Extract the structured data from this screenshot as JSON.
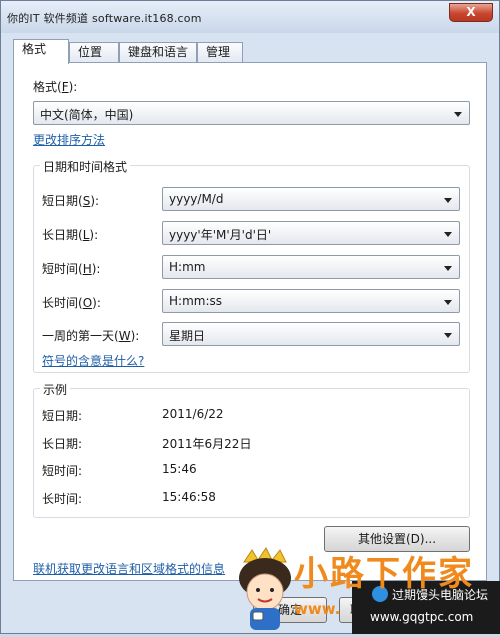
{
  "window": {
    "title": "你的IT 软件频道 software.it168.com",
    "close_label": "X"
  },
  "tabs": [
    {
      "label": "格式"
    },
    {
      "label": "位置"
    },
    {
      "label": "键盘和语言"
    },
    {
      "label": "管理"
    }
  ],
  "format": {
    "label": "格式(F):",
    "label_text": "格式(",
    "label_key": "F",
    "label_end": "):",
    "value": "中文(简体，中国)",
    "sort_link": "更改排序方法"
  },
  "datetime": {
    "group_title": "日期和时间格式",
    "rows": [
      {
        "label": "短日期",
        "key": "S",
        "value": "yyyy/M/d"
      },
      {
        "label": "长日期",
        "key": "L",
        "value": "yyyy'年'M'月'd'日'"
      },
      {
        "label": "短时间",
        "key": "H",
        "value": "H:mm"
      },
      {
        "label": "长时间",
        "key": "O",
        "value": "H:mm:ss"
      },
      {
        "label": "一周的第一天",
        "key": "W",
        "value": "星期日"
      }
    ],
    "symbols_link": "符号的含意是什么?"
  },
  "example": {
    "group_title": "示例",
    "rows": [
      {
        "label": "短日期:",
        "value": "2011/6/22"
      },
      {
        "label": "长日期:",
        "value": "2011年6月22日"
      },
      {
        "label": "短时间:",
        "value": "15:46"
      },
      {
        "label": "长时间:",
        "value": "15:46:58"
      }
    ]
  },
  "other_settings_button": "其他设置(D)...",
  "online_link": "联机获取更改语言和区域格式的信息",
  "footer": {
    "ok_label": "确定",
    "cancel_label_visible": "取"
  },
  "watermark": {
    "brand": "小路下作家",
    "site_url": "www.",
    "forum_text": "过期馒头电脑论坛",
    "forum_url": "www.gqgtpc.com"
  },
  "colors": {
    "link": "#1e5fa8",
    "close_button": "#c9472f",
    "brand_orange": "#f08a1c"
  }
}
